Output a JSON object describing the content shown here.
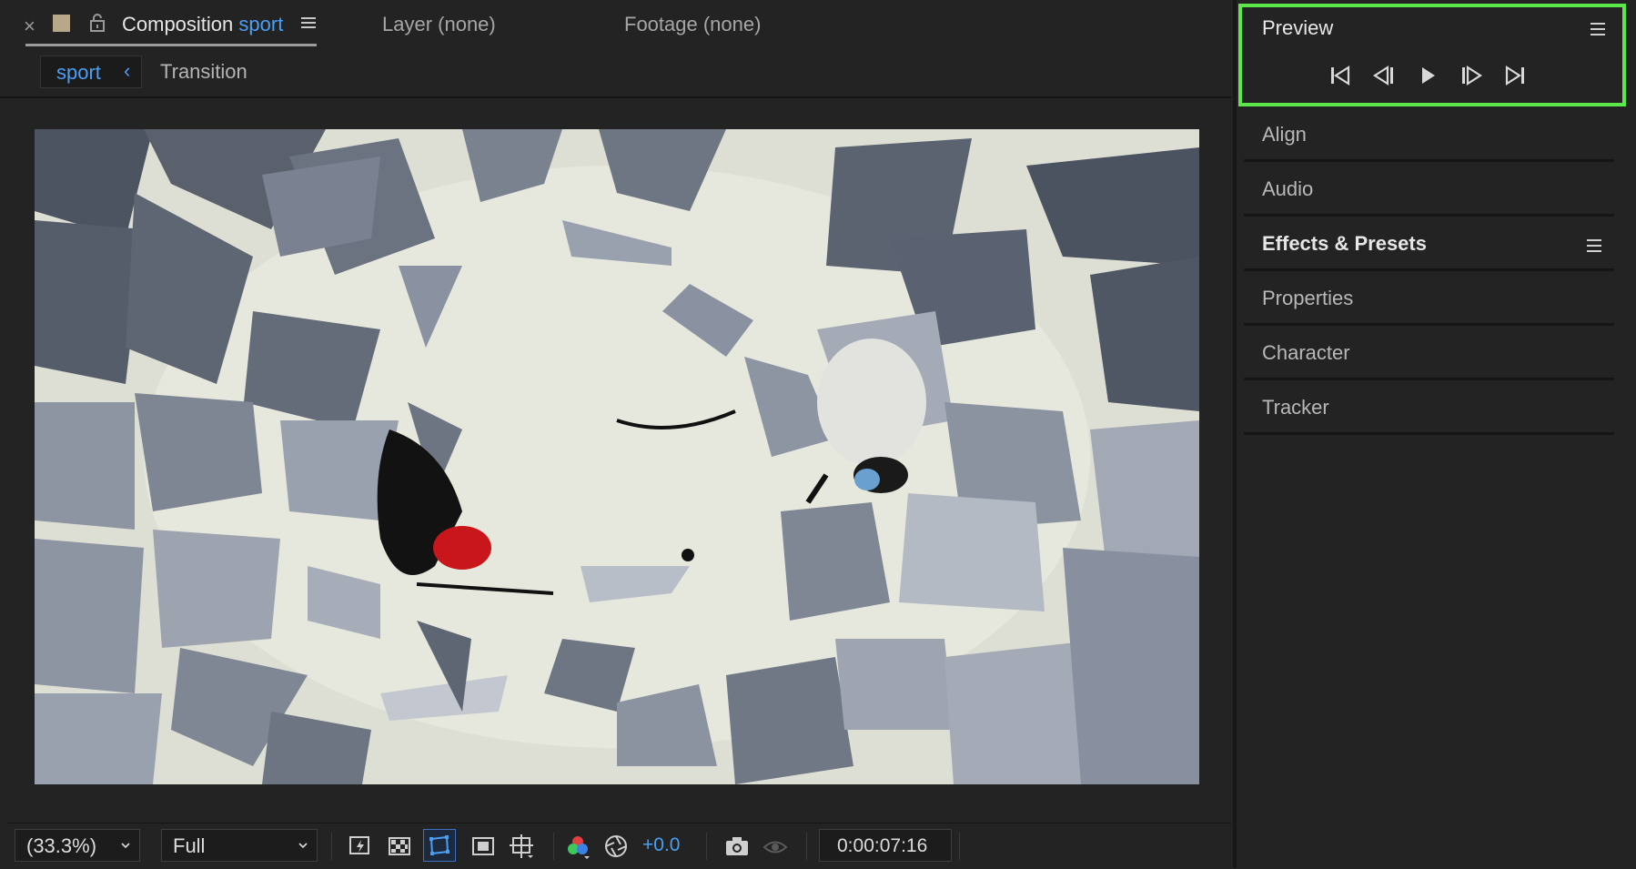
{
  "tabs": {
    "comp_prefix": "Composition",
    "comp_name": "sport",
    "layer": "Layer (none)",
    "footage": "Footage (none)"
  },
  "breadcrumbs": {
    "active": "sport",
    "next": "Transition"
  },
  "bottom_bar": {
    "magnification": "(33.3%)",
    "resolution": "Full",
    "exposure": "+0.0",
    "timecode": "0:00:07:16"
  },
  "right_panel": {
    "preview_title": "Preview",
    "panels": [
      "Align",
      "Audio",
      "Effects & Presets",
      "Properties",
      "Character",
      "Tracker"
    ]
  },
  "colors": {
    "accent": "#4a9ff5",
    "highlight_border": "#5de84a",
    "background": "#232323"
  }
}
